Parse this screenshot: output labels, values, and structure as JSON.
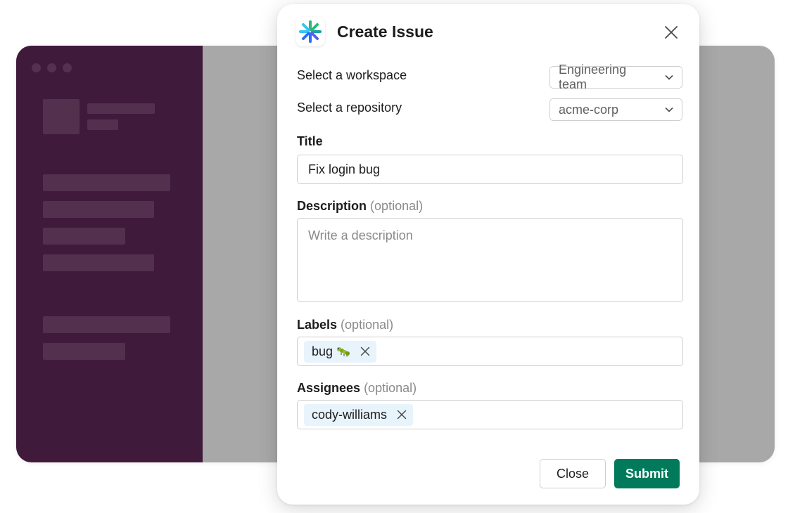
{
  "modal": {
    "title": "Create Issue",
    "app_icon": "asterisk-logo-icon",
    "close_icon": "close-icon"
  },
  "form": {
    "workspace": {
      "label": "Select a workspace",
      "value": "Engineering team"
    },
    "repository": {
      "label": "Select a repository",
      "value": "acme-corp"
    },
    "title": {
      "label": "Title",
      "value": "Fix login bug"
    },
    "description": {
      "label": "Description",
      "optional": "(optional)",
      "placeholder": "Write a description"
    },
    "labels": {
      "label": "Labels",
      "optional": "(optional)",
      "chips": [
        {
          "text": "bug",
          "emoji": "caterpillar-icon"
        }
      ]
    },
    "assignees": {
      "label": "Assignees",
      "optional": "(optional)",
      "chips": [
        {
          "text": "cody-williams"
        }
      ]
    }
  },
  "actions": {
    "close": "Close",
    "submit": "Submit"
  },
  "colors": {
    "sidebar": "#3f1a3b",
    "submit": "#007a5a",
    "chip": "#e8f4fb"
  }
}
